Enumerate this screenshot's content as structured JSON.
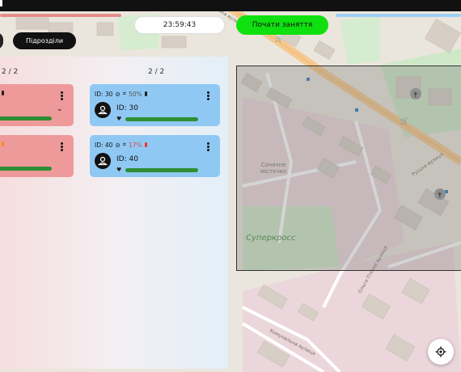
{
  "header": {
    "timer": "23:59:43",
    "start_label": "Почати заняття",
    "subdivisions_label": "Підрозділи"
  },
  "panel": {
    "left_column_count": "2 / 2",
    "right_column_count": "2 / 2",
    "right_cards": [
      {
        "header_id": "ID: 30",
        "battery_pct": "50%",
        "name": "ID: 30",
        "battery_state": "ok"
      },
      {
        "header_id": "ID: 40",
        "battery_pct": "17%",
        "name": "ID: 40",
        "battery_state": "low"
      }
    ]
  },
  "map": {
    "street_1": "Руська вулиця",
    "street_1_top": "ська вулиця",
    "street_2": "Ольги Пчілки вулиця",
    "street_3": "Комунальна вулиця",
    "area_1": "Сонячне містечко",
    "area_2": "Суперкросс"
  },
  "colors": {
    "start_button": "#10e010",
    "red_card": "#ef9a9a",
    "blue_card": "#90c8f4",
    "progress": "#2f8f35"
  },
  "icons": [
    "no-signal-icon",
    "wifi-icon",
    "battery-icon",
    "more-vert-icon",
    "person-icon",
    "heart-icon",
    "chevron-down-icon",
    "my-location-icon"
  ]
}
